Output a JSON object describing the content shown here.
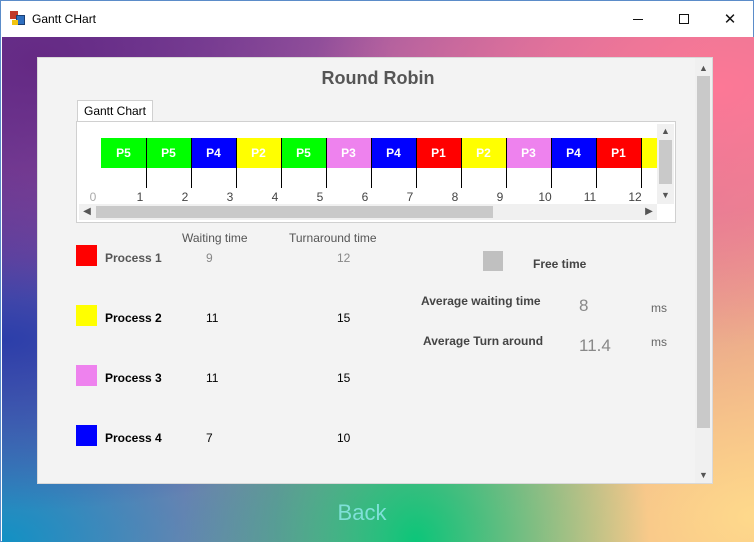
{
  "window": {
    "title": "Gantt CHart",
    "minimize_glyph": "",
    "maximize_glyph": "",
    "close_glyph": "✕"
  },
  "page": {
    "title": "Round Robin"
  },
  "tab": {
    "label": "Gantt Chart"
  },
  "gantt": {
    "blocks": [
      {
        "label": "P5",
        "color": "#00ff00"
      },
      {
        "label": "P5",
        "color": "#00ff00"
      },
      {
        "label": "P4",
        "color": "#0000ff"
      },
      {
        "label": "P2",
        "color": "#ffff00"
      },
      {
        "label": "P5",
        "color": "#00ff00"
      },
      {
        "label": "P3",
        "color": "#ee82ee"
      },
      {
        "label": "P4",
        "color": "#0000ff"
      },
      {
        "label": "P1",
        "color": "#ff0000"
      },
      {
        "label": "P2",
        "color": "#ffff00"
      },
      {
        "label": "P3",
        "color": "#ee82ee"
      },
      {
        "label": "P4",
        "color": "#0000ff"
      },
      {
        "label": "P1",
        "color": "#ff0000"
      },
      {
        "label": "",
        "color": "#ffff00"
      }
    ],
    "time_labels": [
      "0",
      "1",
      "2",
      "3",
      "4",
      "5",
      "6",
      "7",
      "8",
      "9",
      "10",
      "11",
      "12"
    ]
  },
  "table": {
    "waiting_header": "Waiting time",
    "turnaround_header": "Turnaround time",
    "rows": [
      {
        "name": "Process 1",
        "color": "#ff0000",
        "waiting": "9",
        "turnaround": "12"
      },
      {
        "name": "Process 2",
        "color": "#ffff00",
        "waiting": "11",
        "turnaround": "15"
      },
      {
        "name": "Process 3",
        "color": "#ee82ee",
        "waiting": "11",
        "turnaround": "15"
      },
      {
        "name": "Process 4",
        "color": "#0000ff",
        "waiting": "7",
        "turnaround": "10"
      }
    ]
  },
  "stats": {
    "free_time_label": "Free time",
    "free_time_color": "#c0c0c0",
    "avg_waiting_label": "Average waiting time",
    "avg_waiting_value": "8",
    "avg_waiting_unit": "ms",
    "avg_turnaround_label": "Average Turn around",
    "avg_turnaround_value": "11.4",
    "avg_turnaround_unit": "ms"
  },
  "footer": {
    "back_label": "Back"
  }
}
